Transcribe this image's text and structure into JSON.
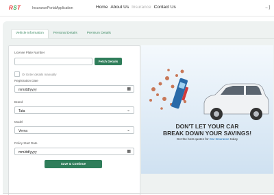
{
  "brand": {
    "logo": "RST",
    "app_name": "InsurancePortalApplication"
  },
  "nav": {
    "items": [
      "Home",
      "About Us",
      "Insurance",
      "Contact Us"
    ],
    "right_label": "←]"
  },
  "tabs": [
    "Vehicle Information",
    "Personal Details",
    "Premium Details"
  ],
  "form": {
    "plate_label": "License Plate Number",
    "plate_value": "",
    "fetch_button": "Fetch Details",
    "manual_label": "Or Enter details manually",
    "reg_date_label": "Registration Date",
    "reg_date_value": "mm/dd/yyyy",
    "brand_label": "Brand",
    "brand_value": "Tata",
    "model_label": "Model",
    "model_value": "Verna",
    "policy_label": "Policy Start Date",
    "policy_value": "mm/dd/yyyy",
    "submit_button": "Save & Continue"
  },
  "banner": {
    "line1": "DON'T LET YOUR CAR",
    "line2": "BREAK DOWN YOUR SAVINGS!",
    "tagline_prefix": "Get the best quotes for ",
    "tagline_highlight": "Car Insurance",
    "tagline_suffix": " today"
  }
}
